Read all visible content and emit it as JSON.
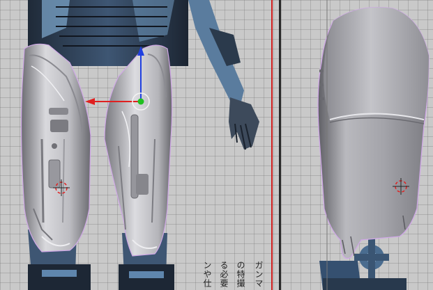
{
  "viewports": [
    {
      "name": "front-view",
      "guide_color": "#d02020"
    },
    {
      "name": "side-view"
    }
  ],
  "reference_text": {
    "columns": [
      "ガンマ",
      "の特撮",
      "る必要",
      "ンや仕"
    ]
  },
  "colors": {
    "grid_bg": "#c9c9c9",
    "armor_light": "#d8d8dc",
    "armor_mid": "#a9a9ae",
    "armor_dark": "#5e5e64",
    "suit_blue": "#4f6d8c",
    "suit_dark": "#1f2a38",
    "gizmo_x": "#e02020",
    "gizmo_y": "#20c020",
    "gizmo_z": "#2040e0",
    "wire_outline": "#c8a0e0"
  },
  "icons": [
    "transform-gizmo-icon",
    "3d-cursor-icon"
  ]
}
